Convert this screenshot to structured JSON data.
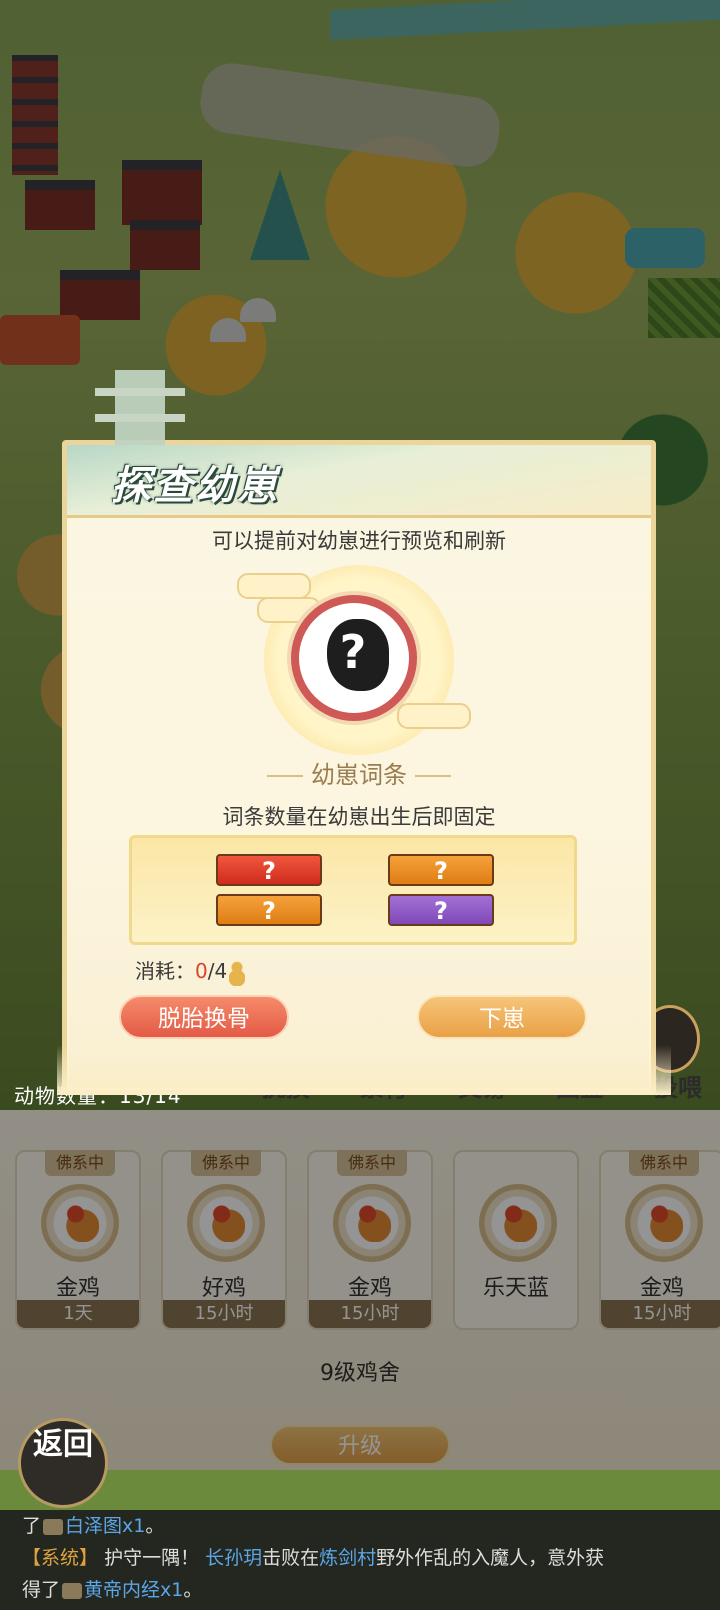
{
  "dialog": {
    "title": "探查幼崽",
    "description": "可以提前对幼崽进行预览和刷新",
    "portrait_icon": "mystery-chick-icon",
    "traits_label": "幼崽词条",
    "traits_description": "词条数量在幼崽出生后即固定",
    "trait_slots": [
      {
        "label": "?",
        "color": "#d8321f"
      },
      {
        "label": "?",
        "color": "#e6861b"
      },
      {
        "label": "?",
        "color": "#e6861b"
      },
      {
        "label": "?",
        "color": "#8c55c4"
      }
    ],
    "cost": {
      "label": "消耗：",
      "used": "0",
      "total": "/4",
      "icon": "gourd-icon"
    },
    "rebirth_button": "脱胎换骨",
    "hatch_button": "下崽"
  },
  "farm": {
    "animal_count_label": "动物数量：13/14",
    "tabs": [
      "抚摸",
      "繁育",
      "交易",
      "图鉴",
      "投喂"
    ],
    "animals": [
      {
        "badge": "佛系中",
        "name": "金鸡",
        "time": "1天"
      },
      {
        "badge": "佛系中",
        "name": "好鸡",
        "time": "15小时"
      },
      {
        "badge": "佛系中",
        "name": "金鸡",
        "time": "15小时"
      },
      {
        "badge": "",
        "name": "乐天蓝",
        "time": ""
      },
      {
        "badge": "佛系中",
        "name": "金鸡",
        "time": "15小时"
      }
    ],
    "coop_level": "9级鸡舍",
    "upgrade_button": "升级",
    "back_button": "返回"
  },
  "chat": {
    "line1_prefix": "了",
    "line1_item": "白泽图x1",
    "line1_suffix": "。",
    "line2_system": "【系统】",
    "line2_text_a": "护守一隅！",
    "line2_name": "长孙玥",
    "line2_text_b": "击败在",
    "line2_place": "炼剑村",
    "line2_text_c": "野外作乱的入魔人，意外获",
    "line3_prefix": "得了",
    "line3_item": "黄帝内经x1",
    "line3_suffix": "。"
  },
  "colors": {
    "accent_orange": "#e9a046",
    "accent_red": "#e35a46",
    "highlight_blue": "#5aa6e6",
    "system_gold": "#e0a33c"
  }
}
